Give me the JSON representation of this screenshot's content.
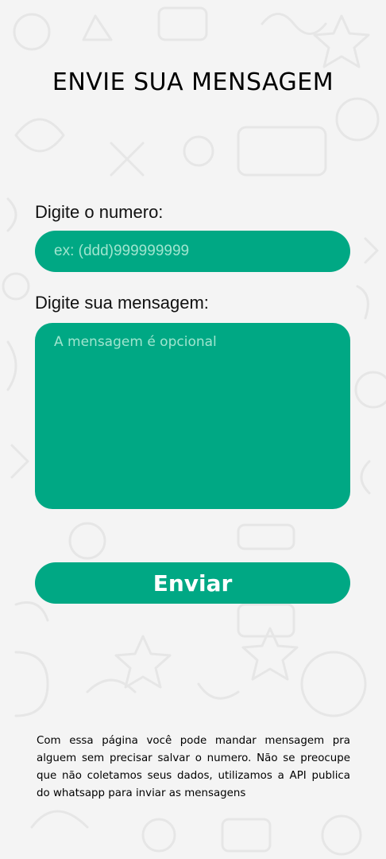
{
  "header": {
    "title": "ENVIE SUA MENSAGEM"
  },
  "form": {
    "number_label": "Digite o numero:",
    "number_placeholder": "ex: (ddd)999999999",
    "message_label": "Digite sua mensagem:",
    "message_placeholder": "A mensagem é opcional",
    "submit_label": "Enviar"
  },
  "footer": {
    "text": "Com essa página você pode mandar mensagem pra alguem sem precisar salvar o numero. Não se preocupe que não coletamos seus dados, utilizamos a API publica do whatsapp para inviar as mensagens"
  },
  "colors": {
    "accent": "#00a884",
    "background": "#f4f4f4",
    "placeholder": "#9fe5cf",
    "button_text": "#ffffff"
  }
}
